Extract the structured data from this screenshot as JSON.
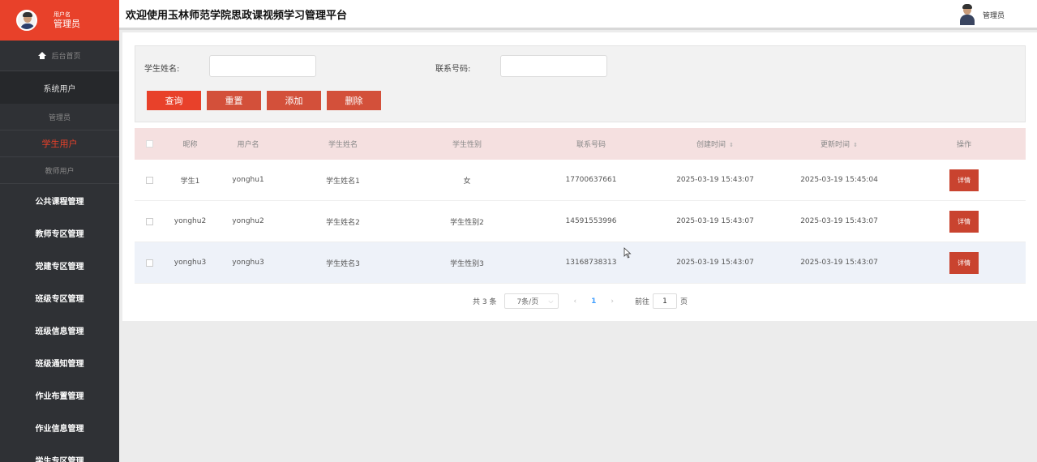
{
  "sidebar": {
    "user_label_small": "用户名",
    "user_label_big": "管理员",
    "home": "后台首页",
    "group_system": "系统用户",
    "sub_admin": "管理员",
    "sub_student": "学生用户",
    "sub_teacher": "教师用户",
    "items": [
      {
        "label": "公共课程管理"
      },
      {
        "label": "教师专区管理"
      },
      {
        "label": "党建专区管理"
      },
      {
        "label": "班级专区管理"
      },
      {
        "label": "班级信息管理"
      },
      {
        "label": "班级通知管理"
      },
      {
        "label": "作业布置管理"
      },
      {
        "label": "作业信息管理"
      },
      {
        "label": "学生专区管理"
      }
    ]
  },
  "header": {
    "title": "欢迎使用玉林师范学院思政课视频学习管理平台",
    "admin_name": "管理员"
  },
  "search": {
    "name_label": "学生姓名:",
    "phone_label": "联系号码:",
    "name_value": "",
    "phone_value": ""
  },
  "buttons": {
    "query": "查询",
    "reset": "重置",
    "add": "添加",
    "delete": "删除"
  },
  "table": {
    "headers": [
      "昵称",
      "用户名",
      "学生姓名",
      "学生性别",
      "联系号码",
      "创建时间",
      "更新时间",
      "操作"
    ],
    "rows": [
      {
        "nick": "学生1",
        "username": "yonghu1",
        "name": "学生姓名1",
        "gender": "女",
        "phone": "17700637661",
        "created": "2025-03-19 15:43:07",
        "updated": "2025-03-19 15:45:04",
        "action": "详情"
      },
      {
        "nick": "yonghu2",
        "username": "yonghu2",
        "name": "学生姓名2",
        "gender": "学生性别2",
        "phone": "14591553996",
        "created": "2025-03-19 15:43:07",
        "updated": "2025-03-19 15:43:07",
        "action": "详情"
      },
      {
        "nick": "yonghu3",
        "username": "yonghu3",
        "name": "学生姓名3",
        "gender": "学生性别3",
        "phone": "13168738313",
        "created": "2025-03-19 15:43:07",
        "updated": "2025-03-19 15:43:07",
        "action": "详情"
      }
    ]
  },
  "pager": {
    "total": "共 3 条",
    "page_size": "7条/页",
    "current_page": "1",
    "goto_label": "前往",
    "goto_value": "1",
    "unit": "页"
  },
  "colors": {
    "accent": "#e8412a",
    "sidebar_bg": "#2f3135",
    "table_header_bg": "#f5e0e0"
  }
}
